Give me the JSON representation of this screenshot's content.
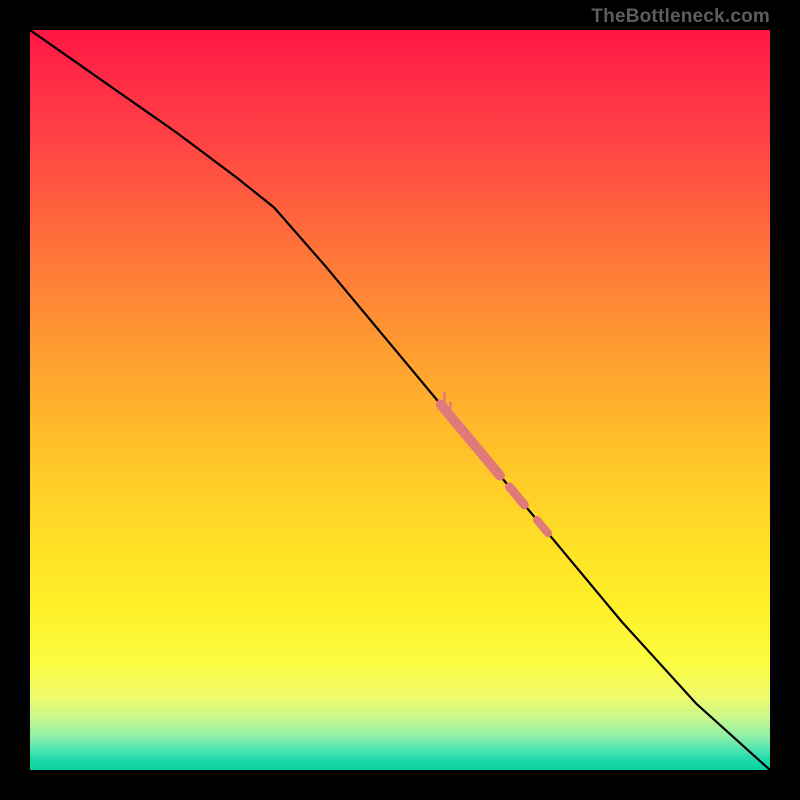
{
  "watermark": "TheBottleneck.com",
  "colors": {
    "highlight": "#e07a7a",
    "curve": "#000000"
  },
  "chart_data": {
    "type": "line",
    "title": "",
    "xlabel": "",
    "ylabel": "",
    "xlim": [
      0,
      1
    ],
    "ylim": [
      0,
      1
    ],
    "series": [
      {
        "name": "curve",
        "points": [
          [
            0.0,
            1.0
          ],
          [
            0.1,
            0.93
          ],
          [
            0.2,
            0.86
          ],
          [
            0.28,
            0.8
          ],
          [
            0.33,
            0.76
          ],
          [
            0.4,
            0.68
          ],
          [
            0.5,
            0.56
          ],
          [
            0.6,
            0.44
          ],
          [
            0.7,
            0.32
          ],
          [
            0.8,
            0.2
          ],
          [
            0.9,
            0.09
          ],
          [
            1.0,
            0.0
          ]
        ]
      }
    ],
    "highlight_segments": [
      {
        "x0": 0.555,
        "x1": 0.635,
        "width": 10
      },
      {
        "x0": 0.648,
        "x1": 0.668,
        "width": 9
      },
      {
        "x0": 0.685,
        "x1": 0.7,
        "width": 8
      }
    ],
    "highlight_drips": [
      {
        "x": 0.56,
        "len": 10
      },
      {
        "x": 0.568,
        "len": 7
      }
    ]
  }
}
